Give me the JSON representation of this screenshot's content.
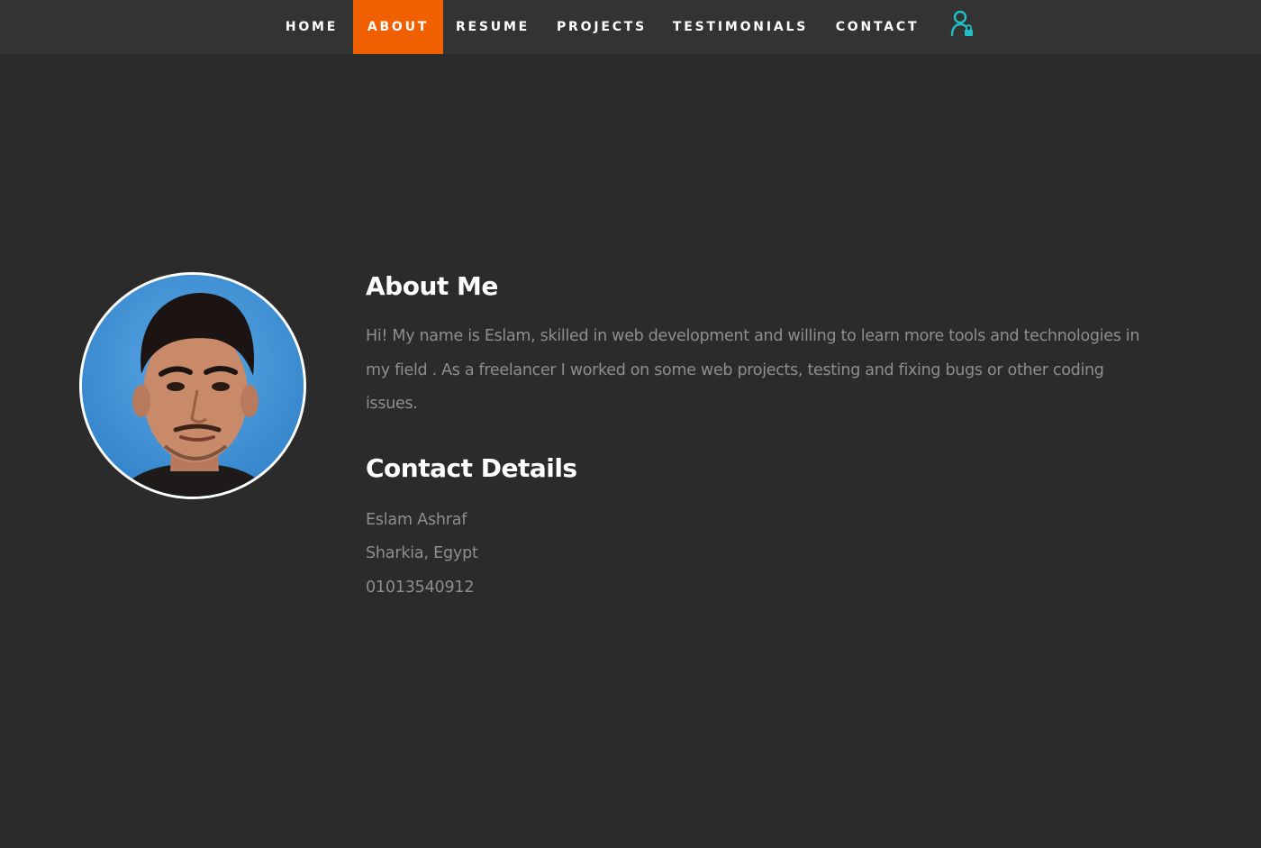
{
  "nav": {
    "items": [
      {
        "label": "HOME"
      },
      {
        "label": "ABOUT"
      },
      {
        "label": "RESUME"
      },
      {
        "label": "PROJECTS"
      },
      {
        "label": "TESTIMONIALS"
      },
      {
        "label": "CONTACT"
      }
    ],
    "active": "ABOUT",
    "login_icon": "user-lock-icon"
  },
  "about": {
    "heading": "About Me",
    "text": "Hi! My name is Eslam, skilled in web development and willing to learn more tools and technologies in my field . As a freelancer I worked on some web projects, testing and fixing bugs or other coding issues."
  },
  "contact": {
    "heading": "Contact Details",
    "name": "Eslam Ashraf",
    "location": "Sharkia, Egypt",
    "phone": "01013540912"
  },
  "colors": {
    "background": "#2b2b2b",
    "navbar": "#333333",
    "accent": "#f06000",
    "icon": "#1fc1c9",
    "body_text": "#8e8e8e"
  }
}
